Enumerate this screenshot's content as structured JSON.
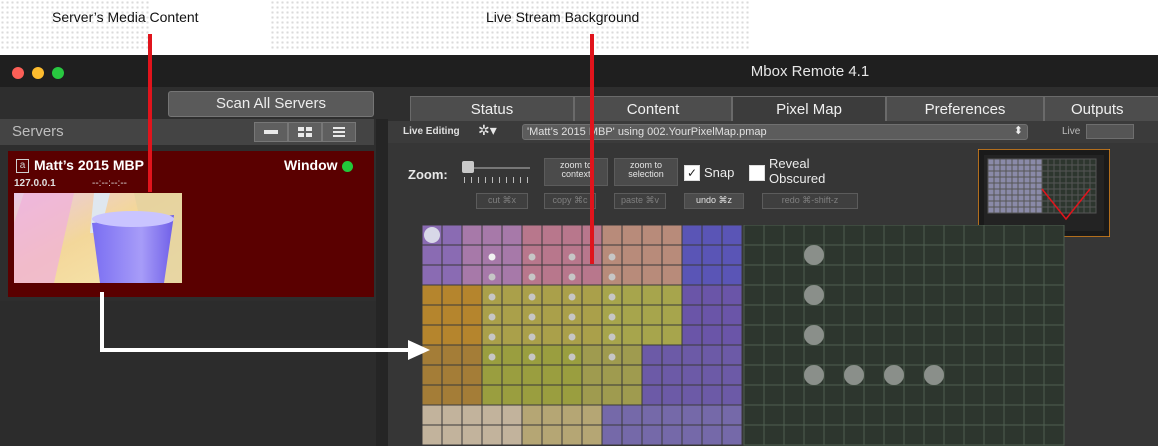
{
  "annotations": {
    "media_content": "Server’s Media Content",
    "live_background": "Live Stream Background"
  },
  "window": {
    "title": "Mbox Remote 4.1"
  },
  "toolbar": {
    "scan_label": "Scan All Servers"
  },
  "tabs": [
    {
      "label": "Status",
      "active": false
    },
    {
      "label": "Content",
      "active": false
    },
    {
      "label": "Pixel Map",
      "active": true
    },
    {
      "label": "Preferences",
      "active": false
    },
    {
      "label": "Outputs",
      "active": false
    }
  ],
  "servers_panel": {
    "title": "Servers",
    "server": {
      "name": "Matt’s 2015 MBP",
      "mode": "Window",
      "ip": "127.0.0.1",
      "status_text": "--:--:--:--",
      "status_color": "#22c93a"
    }
  },
  "pixel_map": {
    "live_editing_label": "Live Editing",
    "file_select": "'Matt’s 2015 MBP' using 002.YourPixelMap.pmap",
    "live_label": "Live",
    "zoom_label": "Zoom:",
    "zoom_context": "zoom to context",
    "zoom_selection": "zoom to selection",
    "snap_label": "Snap",
    "snap_checked": true,
    "reveal_label": "Reveal Obscured",
    "reveal_checked": false,
    "cut": "cut ⌘x",
    "copy": "copy ⌘c",
    "paste": "paste ⌘v",
    "undo": "undo ⌘z",
    "redo": "redo ⌘-shift-z"
  },
  "colors": {
    "accent_red": "#e0141c",
    "server_bg": "#5a0000",
    "selection_orange": "#e58a1e"
  }
}
